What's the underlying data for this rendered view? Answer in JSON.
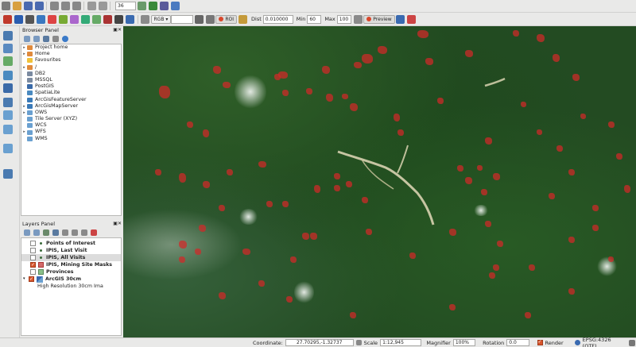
{
  "toolbar": {
    "row1_icons": [
      "new-project-icon",
      "open-project-icon",
      "save-project-icon",
      "save-as-icon",
      "cut-icon",
      "copy-icon",
      "paste-icon",
      "undo-icon",
      "redo-icon",
      "layer-icon",
      "processing-icon",
      "script-icon",
      "python-icon"
    ],
    "zoom_value": "36",
    "rgb_select": "RGB ▾",
    "roi_label": "ROI",
    "dist_label": "Dist",
    "dist_value": "0.010000",
    "min_label": "Min",
    "min_value": "60",
    "max_label": "Max",
    "max_value": "100",
    "preview_label": "Preview"
  },
  "browser_panel": {
    "title": "Browser Panel",
    "items": [
      {
        "label": "Project home",
        "arrow": "▸",
        "color": "#e08a3c"
      },
      {
        "label": "Home",
        "arrow": "▸",
        "color": "#e08a3c"
      },
      {
        "label": "Favourites",
        "arrow": "",
        "color": "#f0c23a"
      },
      {
        "label": "/",
        "arrow": "▸",
        "color": "#e08a3c"
      },
      {
        "label": "DB2",
        "arrow": "",
        "color": "#7a8aa0"
      },
      {
        "label": "MSSQL",
        "arrow": "",
        "color": "#7a8aa0"
      },
      {
        "label": "PostGIS",
        "arrow": "",
        "color": "#3a6aa8"
      },
      {
        "label": "SpatiaLite",
        "arrow": "",
        "color": "#4a8ac0"
      },
      {
        "label": "ArcGisFeatureServer",
        "arrow": "",
        "color": "#3a7ab8"
      },
      {
        "label": "ArcGisMapServer",
        "arrow": "▸",
        "color": "#3a7ab8"
      },
      {
        "label": "OWS",
        "arrow": "▸",
        "color": "#6aa0d0"
      },
      {
        "label": "Tile Server (XYZ)",
        "arrow": "",
        "color": "#6aa0d0"
      },
      {
        "label": "WCS",
        "arrow": "",
        "color": "#6aa0d0"
      },
      {
        "label": "WFS",
        "arrow": "▸",
        "color": "#6aa0d0"
      },
      {
        "label": "WMS",
        "arrow": "",
        "color": "#6aa0d0"
      }
    ]
  },
  "layers_panel": {
    "title": "Layers Panel",
    "layers": [
      {
        "label": "Points of Interest",
        "checked": false,
        "indent": 1,
        "bold": true,
        "sym": "point"
      },
      {
        "label": "IPIS, Last Visit",
        "checked": false,
        "indent": 1,
        "bold": true,
        "sym": "point"
      },
      {
        "label": "IPIS, All Visits",
        "checked": false,
        "indent": 1,
        "bold": true,
        "sym": "point",
        "selected": true
      },
      {
        "label": "IPIS, Mining Site Masks",
        "checked": true,
        "indent": 1,
        "bold": true,
        "sym": "poly-red"
      },
      {
        "label": "Provinces",
        "checked": false,
        "indent": 1,
        "bold": true,
        "sym": "poly-green"
      },
      {
        "label": "ArcGIS 30cm",
        "checked": true,
        "indent": 0,
        "bold": true,
        "sym": "raster",
        "arrow": "▾"
      },
      {
        "label": "High Resolution 30cm Ima",
        "checked": null,
        "indent": 2,
        "bold": false,
        "sym": "none"
      }
    ]
  },
  "status": {
    "coordinate_label": "Coordinate:",
    "coordinate_value": "27.70295,-1.32737",
    "scale_label": "Scale",
    "scale_value": "1:12,945",
    "magnifier_label": "Magnifier",
    "magnifier_value": "100%",
    "rotation_label": "Rotation",
    "rotation_value": "0.0",
    "render_label": "Render",
    "crs_label": "EPSG:4326 (OTF)"
  },
  "colors": {
    "mask": "#d22828",
    "accent": "#d8552c",
    "forest": "#234b22"
  }
}
